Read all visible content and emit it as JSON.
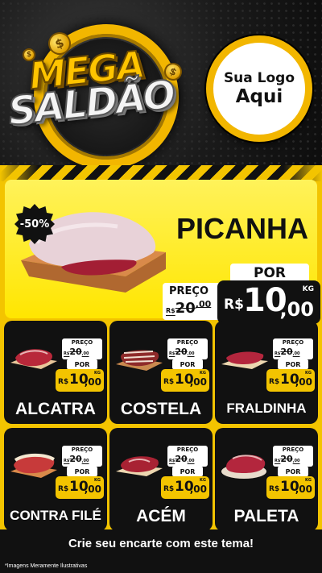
{
  "header": {
    "title_line1": "MEGA",
    "title_line2": "SALDÃO",
    "logo_line1": "Sua Logo",
    "logo_line2": "Aqui",
    "coin_symbol": "$"
  },
  "hero": {
    "discount": "-50%",
    "product": "PICANHA",
    "old_label": "PREÇO",
    "old_currency": "R$",
    "old_value": "20",
    "old_cents": ",00",
    "por_label": "POR",
    "currency": "R$",
    "price_int": "10",
    "price_cents": ",00",
    "unit": "KG"
  },
  "grid": [
    {
      "name": "ALCATRA",
      "old_label": "PREÇO",
      "old_currency": "R$",
      "old_value": "20",
      "old_cents": ",00",
      "por_label": "POR",
      "currency": "R$",
      "price_int": "10",
      "price_cents": ",00",
      "unit": "KG"
    },
    {
      "name": "COSTELA",
      "old_label": "PREÇO",
      "old_currency": "R$",
      "old_value": "20",
      "old_cents": ",00",
      "por_label": "POR",
      "currency": "R$",
      "price_int": "10",
      "price_cents": ",00",
      "unit": "KG"
    },
    {
      "name": "FRALDINHA",
      "old_label": "PREÇO",
      "old_currency": "R$",
      "old_value": "20",
      "old_cents": ",00",
      "por_label": "POR",
      "currency": "R$",
      "price_int": "10",
      "price_cents": ",00",
      "unit": "KG"
    },
    {
      "name": "CONTRA FILÉ",
      "old_label": "PREÇO",
      "old_currency": "R$",
      "old_value": "20",
      "old_cents": ",00",
      "por_label": "POR",
      "currency": "R$",
      "price_int": "10",
      "price_cents": ",00",
      "unit": "KG"
    },
    {
      "name": "ACÉM",
      "old_label": "PREÇO",
      "old_currency": "R$",
      "old_value": "20",
      "old_cents": ",00",
      "por_label": "POR",
      "currency": "R$",
      "price_int": "10",
      "price_cents": ",00",
      "unit": "KG"
    },
    {
      "name": "PALETA",
      "old_label": "PREÇO",
      "old_currency": "R$",
      "old_value": "20",
      "old_cents": ",00",
      "por_label": "POR",
      "currency": "R$",
      "price_int": "10",
      "price_cents": ",00",
      "unit": "KG"
    }
  ],
  "footer": {
    "cta": "Crie seu encarte com este tema!",
    "disclaimer": "*Imagens Meramente Ilustrativas"
  },
  "colors": {
    "accent": "#f3c400",
    "dark": "#111111",
    "meat": "#b8283a",
    "board": "#d98a4a"
  }
}
